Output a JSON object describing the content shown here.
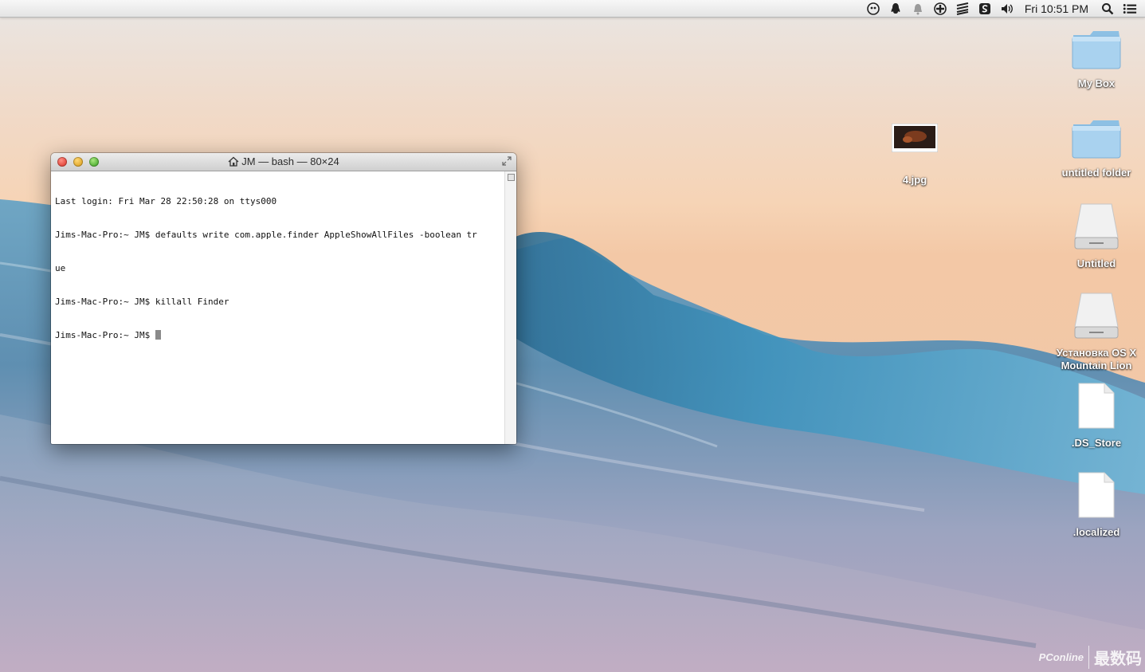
{
  "menubar": {
    "icons": [
      "tweetbot-icon",
      "qq-icon",
      "notification-bell-icon",
      "game-icon",
      "stack-icon",
      "sketch-app-icon",
      "volume-icon"
    ],
    "clock": "Fri 10:51 PM",
    "search_icon": "spotlight-search-icon",
    "list_icon": "notification-center-icon"
  },
  "terminal": {
    "title": "JM — bash — 80×24",
    "lines": [
      "Last login: Fri Mar 28 22:50:28 on ttys000",
      "Jims-Mac-Pro:~ JM$ defaults write com.apple.finder AppleShowAllFiles -boolean tr",
      "ue",
      "Jims-Mac-Pro:~ JM$ killall Finder",
      "Jims-Mac-Pro:~ JM$ "
    ]
  },
  "desktop": {
    "icons": [
      {
        "label": "My Box",
        "kind": "folder"
      },
      {
        "label": "4.jpg",
        "kind": "image"
      },
      {
        "label": "untitled folder",
        "kind": "folder"
      },
      {
        "label": "Untitled",
        "kind": "drive"
      },
      {
        "label": "Установка OS X Mountain Lion",
        "kind": "drive"
      },
      {
        "label": ".DS_Store",
        "kind": "document"
      },
      {
        "label": ".localized",
        "kind": "document"
      }
    ]
  },
  "watermark": {
    "brand": "PConline",
    "text": "最数码"
  }
}
